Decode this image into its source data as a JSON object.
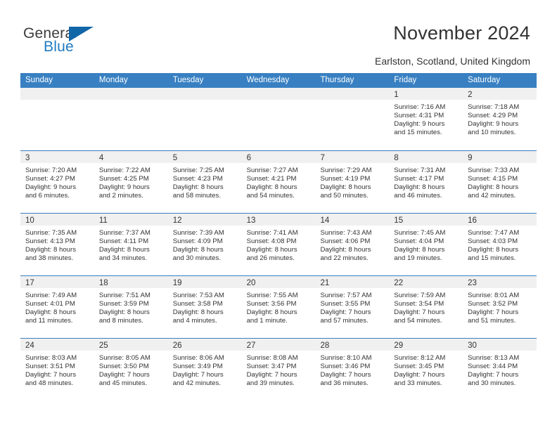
{
  "brand": {
    "name_part1": "General",
    "name_part2": "Blue",
    "logo_icon": "triangle-icon",
    "accent_color": "#1166a8"
  },
  "header": {
    "title": "November 2024",
    "location": "Earlston, Scotland, United Kingdom"
  },
  "calendar": {
    "header_bg_color": "#3880c2",
    "daynum_band_color": "#f0f0f0",
    "weekdays": [
      "Sunday",
      "Monday",
      "Tuesday",
      "Wednesday",
      "Thursday",
      "Friday",
      "Saturday"
    ],
    "weeks": [
      [
        {
          "day": "",
          "empty": true
        },
        {
          "day": "",
          "empty": true
        },
        {
          "day": "",
          "empty": true
        },
        {
          "day": "",
          "empty": true
        },
        {
          "day": "",
          "empty": true
        },
        {
          "day": "1",
          "sunrise": "Sunrise: 7:16 AM",
          "sunset": "Sunset: 4:31 PM",
          "daylight1": "Daylight: 9 hours",
          "daylight2": "and 15 minutes."
        },
        {
          "day": "2",
          "sunrise": "Sunrise: 7:18 AM",
          "sunset": "Sunset: 4:29 PM",
          "daylight1": "Daylight: 9 hours",
          "daylight2": "and 10 minutes."
        }
      ],
      [
        {
          "day": "3",
          "sunrise": "Sunrise: 7:20 AM",
          "sunset": "Sunset: 4:27 PM",
          "daylight1": "Daylight: 9 hours",
          "daylight2": "and 6 minutes."
        },
        {
          "day": "4",
          "sunrise": "Sunrise: 7:22 AM",
          "sunset": "Sunset: 4:25 PM",
          "daylight1": "Daylight: 9 hours",
          "daylight2": "and 2 minutes."
        },
        {
          "day": "5",
          "sunrise": "Sunrise: 7:25 AM",
          "sunset": "Sunset: 4:23 PM",
          "daylight1": "Daylight: 8 hours",
          "daylight2": "and 58 minutes."
        },
        {
          "day": "6",
          "sunrise": "Sunrise: 7:27 AM",
          "sunset": "Sunset: 4:21 PM",
          "daylight1": "Daylight: 8 hours",
          "daylight2": "and 54 minutes."
        },
        {
          "day": "7",
          "sunrise": "Sunrise: 7:29 AM",
          "sunset": "Sunset: 4:19 PM",
          "daylight1": "Daylight: 8 hours",
          "daylight2": "and 50 minutes."
        },
        {
          "day": "8",
          "sunrise": "Sunrise: 7:31 AM",
          "sunset": "Sunset: 4:17 PM",
          "daylight1": "Daylight: 8 hours",
          "daylight2": "and 46 minutes."
        },
        {
          "day": "9",
          "sunrise": "Sunrise: 7:33 AM",
          "sunset": "Sunset: 4:15 PM",
          "daylight1": "Daylight: 8 hours",
          "daylight2": "and 42 minutes."
        }
      ],
      [
        {
          "day": "10",
          "sunrise": "Sunrise: 7:35 AM",
          "sunset": "Sunset: 4:13 PM",
          "daylight1": "Daylight: 8 hours",
          "daylight2": "and 38 minutes."
        },
        {
          "day": "11",
          "sunrise": "Sunrise: 7:37 AM",
          "sunset": "Sunset: 4:11 PM",
          "daylight1": "Daylight: 8 hours",
          "daylight2": "and 34 minutes."
        },
        {
          "day": "12",
          "sunrise": "Sunrise: 7:39 AM",
          "sunset": "Sunset: 4:09 PM",
          "daylight1": "Daylight: 8 hours",
          "daylight2": "and 30 minutes."
        },
        {
          "day": "13",
          "sunrise": "Sunrise: 7:41 AM",
          "sunset": "Sunset: 4:08 PM",
          "daylight1": "Daylight: 8 hours",
          "daylight2": "and 26 minutes."
        },
        {
          "day": "14",
          "sunrise": "Sunrise: 7:43 AM",
          "sunset": "Sunset: 4:06 PM",
          "daylight1": "Daylight: 8 hours",
          "daylight2": "and 22 minutes."
        },
        {
          "day": "15",
          "sunrise": "Sunrise: 7:45 AM",
          "sunset": "Sunset: 4:04 PM",
          "daylight1": "Daylight: 8 hours",
          "daylight2": "and 19 minutes."
        },
        {
          "day": "16",
          "sunrise": "Sunrise: 7:47 AM",
          "sunset": "Sunset: 4:03 PM",
          "daylight1": "Daylight: 8 hours",
          "daylight2": "and 15 minutes."
        }
      ],
      [
        {
          "day": "17",
          "sunrise": "Sunrise: 7:49 AM",
          "sunset": "Sunset: 4:01 PM",
          "daylight1": "Daylight: 8 hours",
          "daylight2": "and 11 minutes."
        },
        {
          "day": "18",
          "sunrise": "Sunrise: 7:51 AM",
          "sunset": "Sunset: 3:59 PM",
          "daylight1": "Daylight: 8 hours",
          "daylight2": "and 8 minutes."
        },
        {
          "day": "19",
          "sunrise": "Sunrise: 7:53 AM",
          "sunset": "Sunset: 3:58 PM",
          "daylight1": "Daylight: 8 hours",
          "daylight2": "and 4 minutes."
        },
        {
          "day": "20",
          "sunrise": "Sunrise: 7:55 AM",
          "sunset": "Sunset: 3:56 PM",
          "daylight1": "Daylight: 8 hours",
          "daylight2": "and 1 minute."
        },
        {
          "day": "21",
          "sunrise": "Sunrise: 7:57 AM",
          "sunset": "Sunset: 3:55 PM",
          "daylight1": "Daylight: 7 hours",
          "daylight2": "and 57 minutes."
        },
        {
          "day": "22",
          "sunrise": "Sunrise: 7:59 AM",
          "sunset": "Sunset: 3:54 PM",
          "daylight1": "Daylight: 7 hours",
          "daylight2": "and 54 minutes."
        },
        {
          "day": "23",
          "sunrise": "Sunrise: 8:01 AM",
          "sunset": "Sunset: 3:52 PM",
          "daylight1": "Daylight: 7 hours",
          "daylight2": "and 51 minutes."
        }
      ],
      [
        {
          "day": "24",
          "sunrise": "Sunrise: 8:03 AM",
          "sunset": "Sunset: 3:51 PM",
          "daylight1": "Daylight: 7 hours",
          "daylight2": "and 48 minutes."
        },
        {
          "day": "25",
          "sunrise": "Sunrise: 8:05 AM",
          "sunset": "Sunset: 3:50 PM",
          "daylight1": "Daylight: 7 hours",
          "daylight2": "and 45 minutes."
        },
        {
          "day": "26",
          "sunrise": "Sunrise: 8:06 AM",
          "sunset": "Sunset: 3:49 PM",
          "daylight1": "Daylight: 7 hours",
          "daylight2": "and 42 minutes."
        },
        {
          "day": "27",
          "sunrise": "Sunrise: 8:08 AM",
          "sunset": "Sunset: 3:47 PM",
          "daylight1": "Daylight: 7 hours",
          "daylight2": "and 39 minutes."
        },
        {
          "day": "28",
          "sunrise": "Sunrise: 8:10 AM",
          "sunset": "Sunset: 3:46 PM",
          "daylight1": "Daylight: 7 hours",
          "daylight2": "and 36 minutes."
        },
        {
          "day": "29",
          "sunrise": "Sunrise: 8:12 AM",
          "sunset": "Sunset: 3:45 PM",
          "daylight1": "Daylight: 7 hours",
          "daylight2": "and 33 minutes."
        },
        {
          "day": "30",
          "sunrise": "Sunrise: 8:13 AM",
          "sunset": "Sunset: 3:44 PM",
          "daylight1": "Daylight: 7 hours",
          "daylight2": "and 30 minutes."
        }
      ]
    ]
  }
}
